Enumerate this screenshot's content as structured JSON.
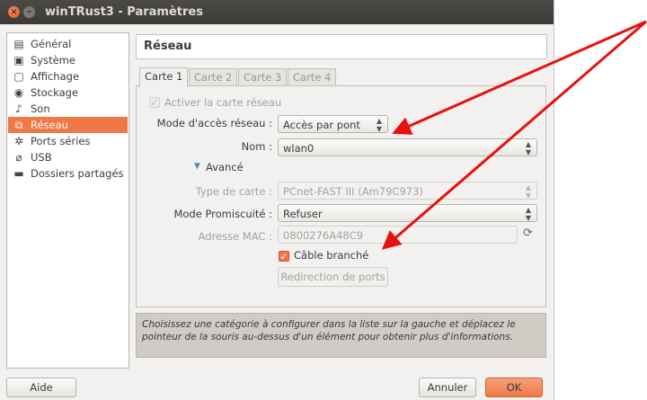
{
  "window": {
    "title": "winTRust3 - Paramètres",
    "close_glyph": "×",
    "min_glyph": "–"
  },
  "sidebar": {
    "items": [
      {
        "label": "Général",
        "icon": "general-icon",
        "glyph": "▤"
      },
      {
        "label": "Système",
        "icon": "system-icon",
        "glyph": "▣"
      },
      {
        "label": "Affichage",
        "icon": "display-icon",
        "glyph": "▢"
      },
      {
        "label": "Stockage",
        "icon": "storage-icon",
        "glyph": "◉"
      },
      {
        "label": "Son",
        "icon": "sound-icon",
        "glyph": "♪"
      },
      {
        "label": "Réseau",
        "icon": "network-icon",
        "glyph": "⧉",
        "selected": true
      },
      {
        "label": "Ports séries",
        "icon": "serial-ports-icon",
        "glyph": "✲"
      },
      {
        "label": "USB",
        "icon": "usb-icon",
        "glyph": "⌀"
      },
      {
        "label": "Dossiers partagés",
        "icon": "shared-folders-icon",
        "glyph": "▬"
      }
    ]
  },
  "section_title": "Réseau",
  "tabs": [
    {
      "label": "Carte 1",
      "active": true
    },
    {
      "label": "Carte 2",
      "active": false
    },
    {
      "label": "Carte 3",
      "active": false
    },
    {
      "label": "Carte 4",
      "active": false
    }
  ],
  "adapter": {
    "enable_label": "Activer la carte réseau",
    "enable_checked": true,
    "enable_disabled": true,
    "attached_label": "Mode d'accès réseau :",
    "attached_value": "Accès par pont",
    "name_label": "Nom :",
    "name_value": "wlan0",
    "advanced_label": "Avancé",
    "type_label": "Type de carte :",
    "type_value": "PCnet-FAST III (Am79C973)",
    "promisc_label": "Mode Promiscuité :",
    "promisc_value": "Refuser",
    "mac_label": "Adresse MAC :",
    "mac_value": "0800276A48C9",
    "cable_label": "Câble branché",
    "cable_checked": true,
    "port_forward_label": "Redirection de ports",
    "check_glyph": "✓",
    "expander_glyph": "▼",
    "refresh_glyph": "⟳",
    "combo_arrows": "▲\n▼"
  },
  "info_text": "Choisissez une catégorie à configurer dans la liste sur la gauche et déplacez le pointeur de la souris au-dessus d'un élément pour obtenir plus d'informations.",
  "buttons": {
    "help": "Aide",
    "cancel": "Annuler",
    "ok": "OK"
  },
  "colors": {
    "accent": "#f07746",
    "annotation_arrow": "#e8100c",
    "titlebar": "#3c3b37"
  }
}
